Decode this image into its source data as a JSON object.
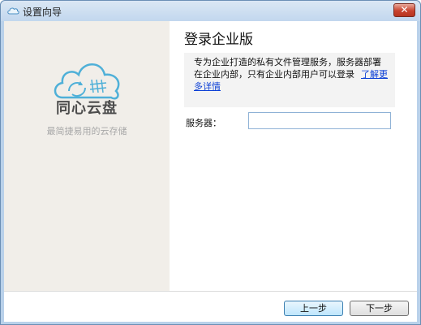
{
  "window": {
    "title": "设置向导",
    "close_glyph": "✕"
  },
  "left_panel": {
    "brand_name": "同心云盘",
    "slogan": "最简捷易用的云存储",
    "logo_icon": "cloud-sync-icon",
    "accent_color": "#4fb0d8"
  },
  "main": {
    "heading": "登录企业版",
    "description": "专为企业打造的私有文件管理服务，服务器部署在企业内部，只有企业内部用户可以登录",
    "details_link": "了解更多详情",
    "server_label": "服务器：",
    "server_value": ""
  },
  "footer": {
    "prev_label": "上一步",
    "next_label": "下一步"
  }
}
